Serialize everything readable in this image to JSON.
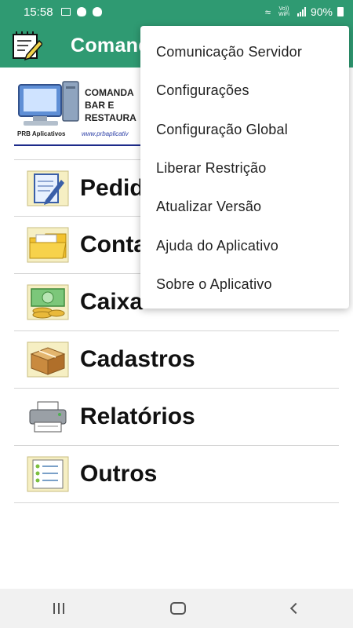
{
  "status_bar": {
    "time": "15:58",
    "battery": "90%",
    "network_label": "Vo)) WiFi"
  },
  "app_bar": {
    "title": "Comandas"
  },
  "banner": {
    "line1": "COMANDA",
    "line2": "BAR E",
    "line3": "RESTAURA",
    "brand": "PRB Aplicativos",
    "url": "www.prbaplicativ"
  },
  "menu": [
    {
      "label": "Pedidos",
      "icon": "notepad-pen-icon"
    },
    {
      "label": "Contas",
      "icon": "folder-icon"
    },
    {
      "label": "Caixa",
      "icon": "cash-icon"
    },
    {
      "label": "Cadastros",
      "icon": "box-icon"
    },
    {
      "label": "Relatórios",
      "icon": "printer-icon"
    },
    {
      "label": "Outros",
      "icon": "list-icon"
    }
  ],
  "dropdown": {
    "items": [
      "Comunicação Servidor",
      "Configurações",
      "Configuração Global",
      "Liberar Restrição",
      "Atualizar Versão",
      "Ajuda do Aplicativo",
      "Sobre o Aplicativo"
    ]
  },
  "colors": {
    "primary": "#2f9a72",
    "accent_yellow": "#f0d24a"
  }
}
